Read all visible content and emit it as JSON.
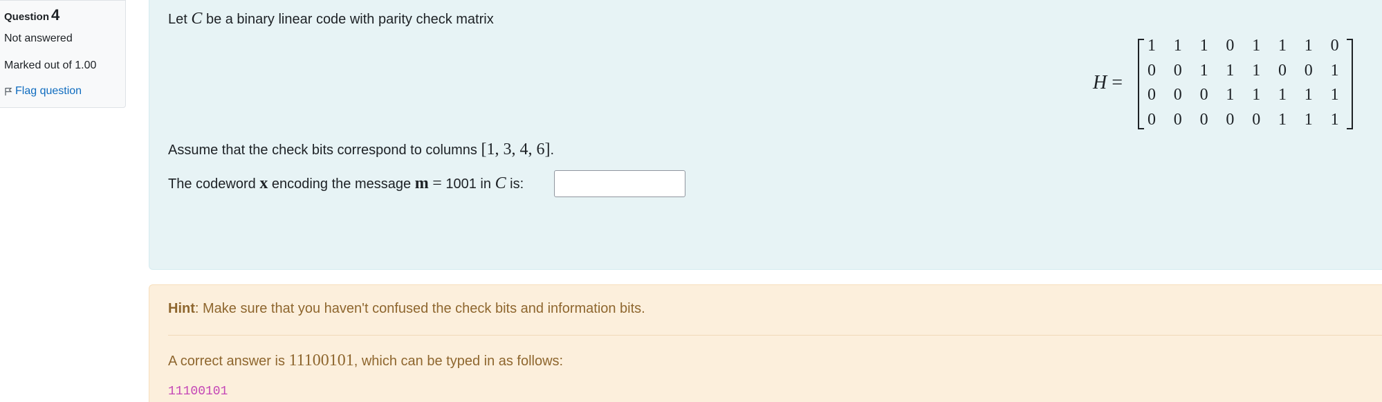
{
  "question": {
    "label": "Question",
    "number": "4",
    "state": "Not answered",
    "grade": "Marked out of 1.00",
    "flag_label": "Flag question"
  },
  "formulation": {
    "intro_pre": "Let",
    "intro_var": "C",
    "intro_post": "be a binary linear code with parity check matrix",
    "matrix_name": "H",
    "matrix_eq": "=",
    "matrix": [
      [
        "1",
        "1",
        "1",
        "0",
        "1",
        "1",
        "1",
        "0"
      ],
      [
        "0",
        "0",
        "1",
        "1",
        "1",
        "0",
        "0",
        "1"
      ],
      [
        "0",
        "0",
        "0",
        "1",
        "1",
        "1",
        "1",
        "1"
      ],
      [
        "0",
        "0",
        "0",
        "0",
        "0",
        "1",
        "1",
        "1"
      ]
    ],
    "assume_pre": "Assume that the check bits correspond to columns",
    "columns": "[1, 3, 4, 6]",
    "assume_post": ".",
    "codeword_pre": "The codeword",
    "codeword_var": "x",
    "codeword_mid": "encoding the message",
    "message_var": "m",
    "message_eq": "=",
    "message_value": "1001",
    "in_text": "in",
    "code_var": "C",
    "is_text": "is:",
    "answer_value": ""
  },
  "feedback": {
    "hint_label": "Hint",
    "hint_text": ": Make sure that you haven't confused the check bits and information bits.",
    "answer_pre": "A correct answer is",
    "answer_value": "11100101",
    "answer_post": ", which can be typed in as follows:",
    "typed_answer": "11100101"
  },
  "colors": {
    "formulation_bg": "#e7f3f5",
    "feedback_bg": "#fcefdc",
    "feedback_text": "#8e662e",
    "code_text": "#c445b6",
    "link": "#0f6cbf"
  }
}
